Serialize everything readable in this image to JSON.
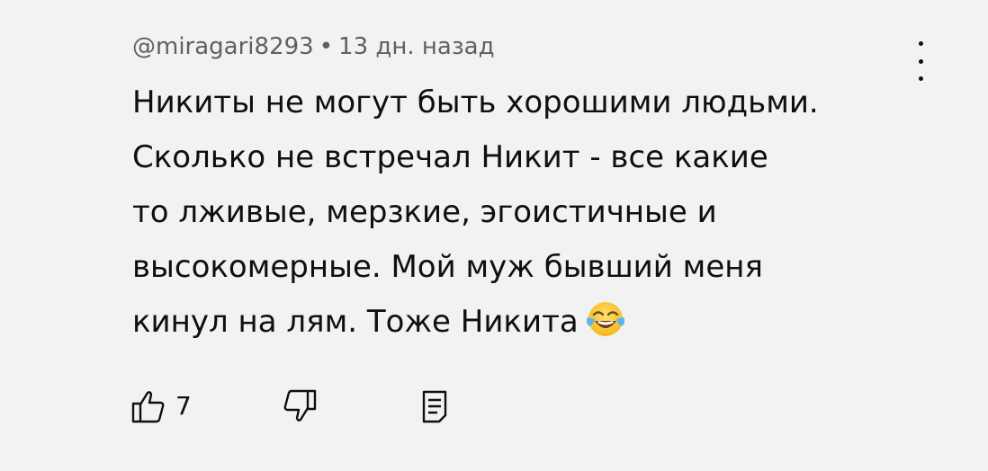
{
  "comment": {
    "author": "@miragari8293",
    "separator": "•",
    "time": "13 дн. назад",
    "text": "Никиты не могут быть хорошими людьми.\nСколько не встречал Никит - все какие\nто лживые, мерзкие, эгоистичные и\nвысокомерные. Мой муж бывший меня\nкинул на лям. Тоже Никита",
    "emoji": "tears-of-joy-emoji"
  },
  "actions": {
    "like_count": "7",
    "like_icon": "thumbs-up-icon",
    "dislike_icon": "thumbs-down-icon",
    "reply_icon": "reply-comment-icon",
    "menu_icon": "more-vertical-icon"
  },
  "colors": {
    "background": "#f2f2f2",
    "text": "#0f0f0f",
    "meta": "#606060"
  }
}
